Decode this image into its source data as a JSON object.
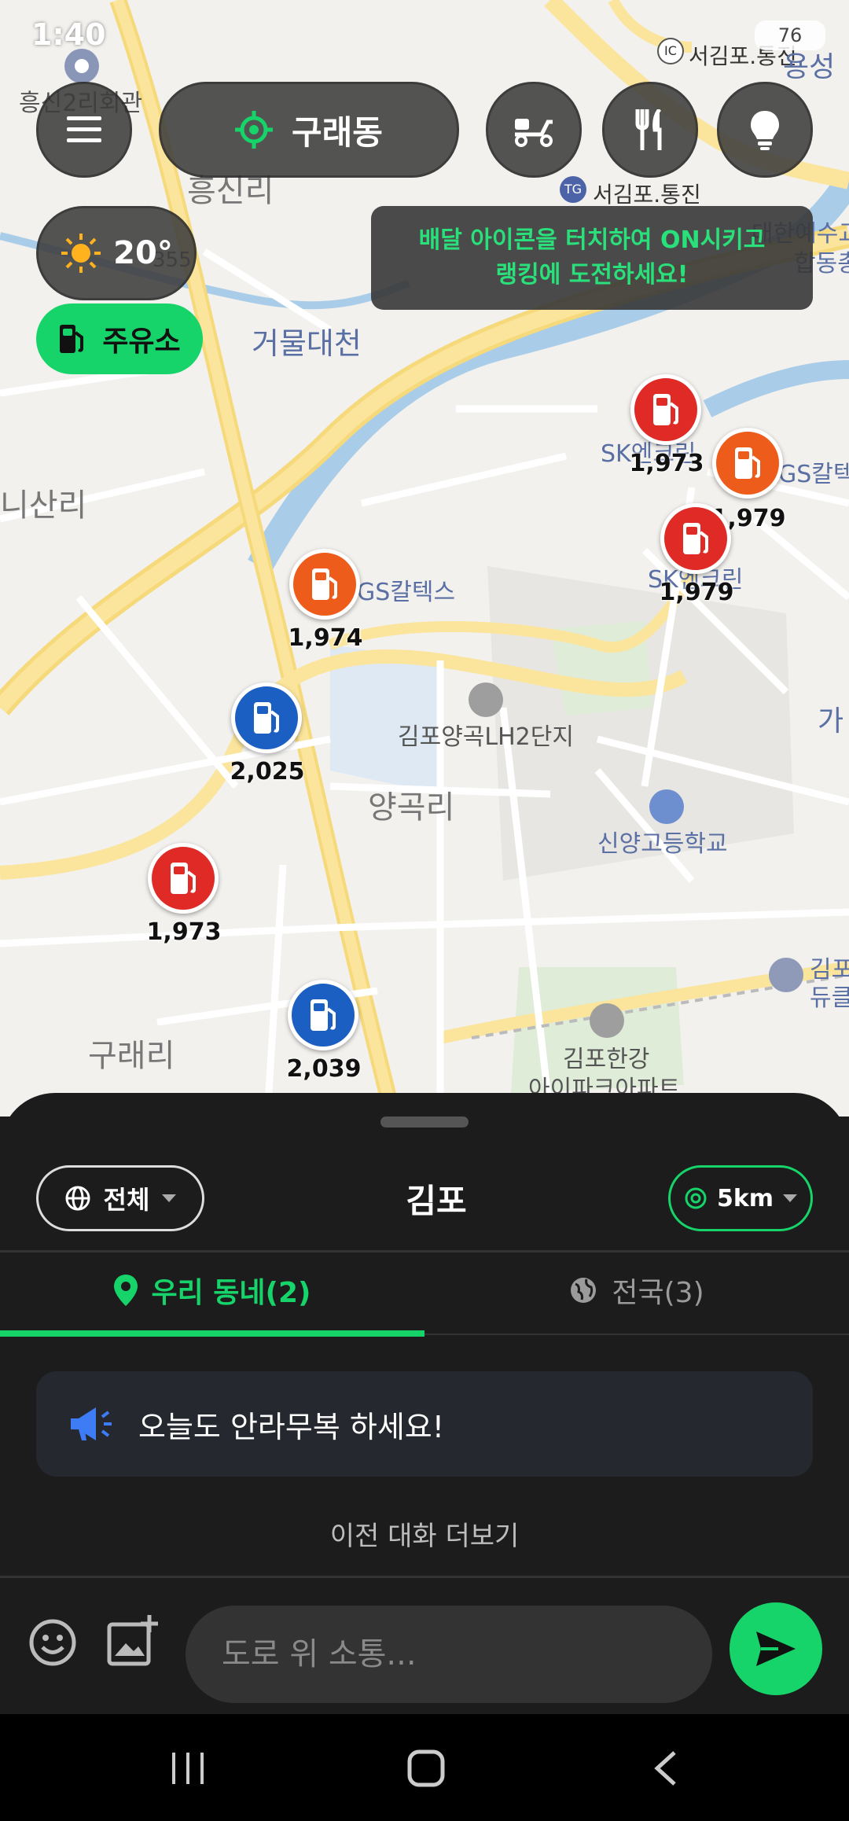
{
  "status": {
    "time": "1:40",
    "battery": "76"
  },
  "map": {
    "labels": {
      "heungsin2": "흥신2리회관",
      "heungsinri": "흥신리",
      "seogimpo_ic": "서김포.통진",
      "seogimpo_tg": "서김포.통진",
      "yongseong": "용성",
      "daehan": "대한예수교",
      "hapdong": "합동총",
      "geomuldaecheon": "거물대천",
      "nisanri": "니산리",
      "gsc1": "GS칼텍스",
      "gsc2": "GS칼텍",
      "sk1": "SK엔크린",
      "sk2": "SK엔크린",
      "lh": "김포양곡LH2단지",
      "yanggokri": "양곡리",
      "school": "신양고등학교",
      "guraeri": "구래리",
      "hangang1": "김포한강",
      "hangang2": "아이파크아파트",
      "gimpo_right": "김포",
      "deul": "듀클",
      "ga": "가",
      "road355": "355"
    },
    "pins": [
      {
        "color": "red",
        "price": "1,973"
      },
      {
        "color": "orange",
        "price": "1,979"
      },
      {
        "color": "red",
        "price": "1,979"
      },
      {
        "color": "orange",
        "price": "1,974"
      },
      {
        "color": "blue",
        "price": "2,025"
      },
      {
        "color": "red",
        "price": "1,973"
      },
      {
        "color": "blue",
        "price": "2,039"
      }
    ]
  },
  "top": {
    "location": "구래동",
    "weather_temp": "20°",
    "gas_label": "주유소",
    "tooltip_line1": "배달 아이콘을 터치하여 ON시키고",
    "tooltip_line2": "랭킹에 도전하세요!"
  },
  "sheet": {
    "filter_label": "전체",
    "title": "김포",
    "radius_label": "5km",
    "tab_local": "우리 동네(2)",
    "tab_nation": "전국(3)",
    "notice": "오늘도 안라무복 하세요!",
    "more_chat": "이전 대화 더보기",
    "input_placeholder": "도로 위 소통..."
  },
  "colors": {
    "accent": "#16d46a",
    "pin_red": "#e02a26",
    "pin_orange": "#ee5c1c",
    "pin_blue": "#1b5fc2"
  }
}
